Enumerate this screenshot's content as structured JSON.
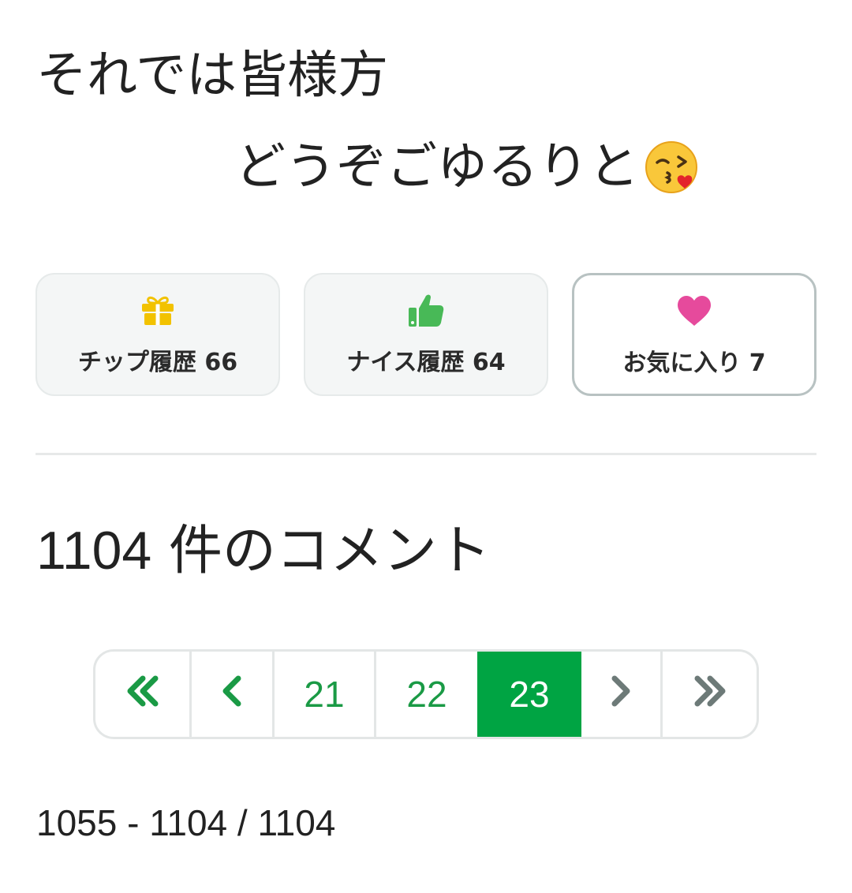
{
  "message": {
    "line1": "それでは皆様方",
    "line2": "どうぞごゆるりと",
    "emoji": "kissing-face-with-heart-icon"
  },
  "actions": [
    {
      "icon": "gift-icon",
      "label": "チップ履歴 66",
      "color": "#f2c200"
    },
    {
      "icon": "thumbs-up-icon",
      "label": "ナイス履歴 64",
      "color": "#48b957"
    },
    {
      "icon": "heart-icon",
      "label": "お気に入り 7",
      "color": "#e64a9c"
    }
  ],
  "comments": {
    "count": "1104",
    "label": "件のコメント"
  },
  "pagination": {
    "first_icon": "double-chevron-left-icon",
    "prev_icon": "chevron-left-icon",
    "pages": [
      "21",
      "22",
      "23"
    ],
    "current": "23",
    "next_icon": "chevron-right-icon",
    "last_icon": "double-chevron-right-icon",
    "active_color": "#00a443",
    "link_color": "#1a9a45"
  },
  "range_text": "1055 - 1104 / 1104"
}
